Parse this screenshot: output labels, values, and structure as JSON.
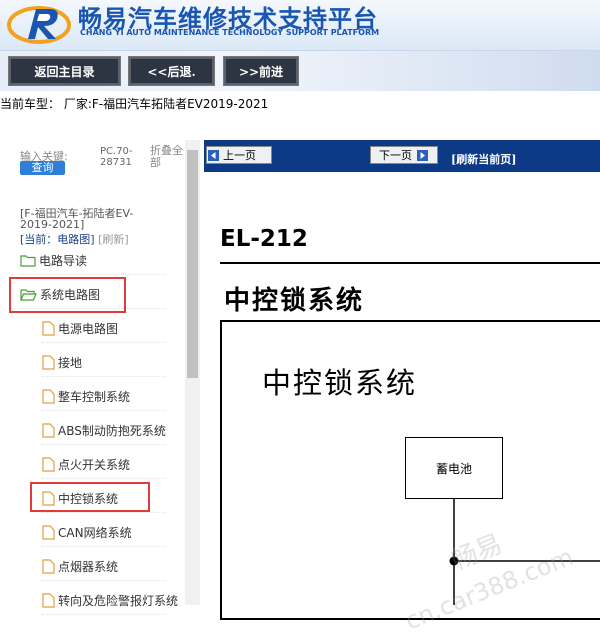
{
  "brand": {
    "title_cn": "畅易汽车维修技术支持平台",
    "title_en": "CHANG YI AUTO MAINTENANCE TECHNOLOGY SUPPORT PLATFORM"
  },
  "toolbar": {
    "home_label": "返回主目录",
    "back_label": "<<后退.",
    "forward_label": ">>前进"
  },
  "vehicle_line": "当前车型： 厂家:F-福田汽车拓陆者EV2019-2021",
  "sidebar": {
    "keyword_label": "输入关键:",
    "search_label": "查询",
    "pc_code": "PC.70-28731",
    "collapse_label": "折叠全部",
    "crumb_car": "[F-福田汽车-拓陆者EV-2019-2021]",
    "crumb_current": "[当前：电路图]",
    "crumb_refresh": "[刷新]",
    "tree": [
      {
        "label": "电路导读",
        "icon": "folder-closed"
      },
      {
        "label": "系统电路图",
        "icon": "folder-open"
      },
      {
        "label": "电源电路图",
        "icon": "page"
      },
      {
        "label": "接地",
        "icon": "page"
      },
      {
        "label": "整车控制系统",
        "icon": "page"
      },
      {
        "label": "ABS制动防抱死系统",
        "icon": "page"
      },
      {
        "label": "点火开关系统",
        "icon": "page"
      },
      {
        "label": "中控锁系统",
        "icon": "page"
      },
      {
        "label": "CAN网络系统",
        "icon": "page"
      },
      {
        "label": "点烟器系统",
        "icon": "page"
      },
      {
        "label": "转向及危险警报灯系统",
        "icon": "page"
      }
    ]
  },
  "content": {
    "prev_label": "上一页",
    "next_label": "下一页",
    "refresh_label": "[刷新当前页]",
    "page_code": "EL-212",
    "page_title": "中控锁系统",
    "diagram_title": "中控锁系统",
    "battery_label": "蓄电池"
  },
  "watermarks": [
    "畅易",
    "cn.car388.com"
  ],
  "colors": {
    "brand_blue": "#1a56b0",
    "nav_bar": "#0c3a86",
    "highlight_red": "#e03c3c",
    "search_blue": "#2f7fd8"
  }
}
